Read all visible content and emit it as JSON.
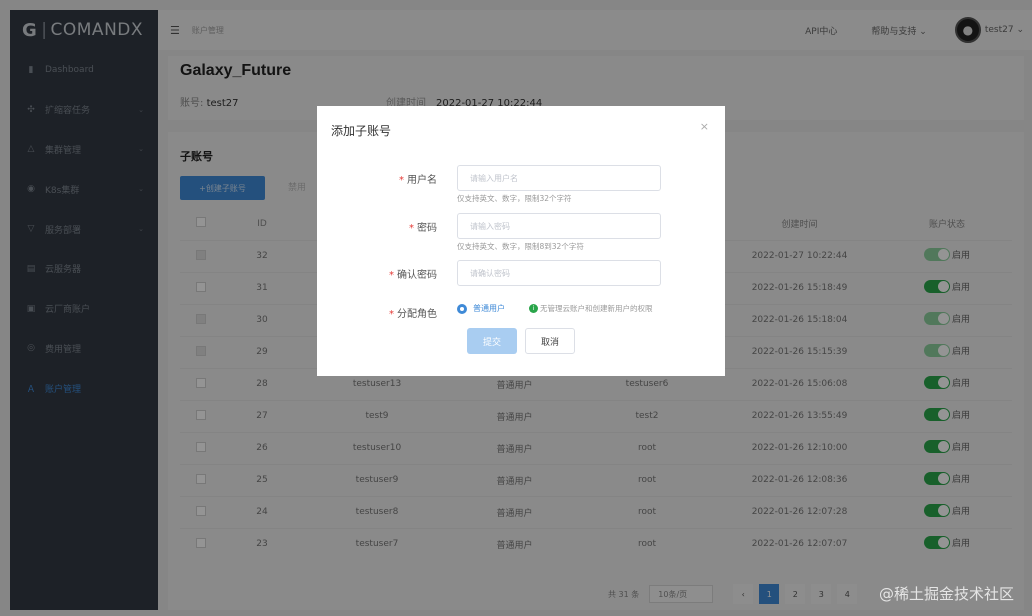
{
  "app": {
    "logo_text": "COMANDX"
  },
  "sidebar": {
    "items": [
      {
        "label": "Dashboard",
        "icon": "bar-chart-icon",
        "glyph": "▮",
        "chevron": false
      },
      {
        "label": "扩缩容任务",
        "icon": "scale-icon",
        "glyph": "✣",
        "chevron": true
      },
      {
        "label": "集群管理",
        "icon": "cluster-icon",
        "glyph": "△",
        "chevron": true
      },
      {
        "label": "K8s集群",
        "icon": "k8s-icon",
        "glyph": "◉",
        "chevron": true
      },
      {
        "label": "服务部署",
        "icon": "deploy-icon",
        "glyph": "▽",
        "chevron": true
      },
      {
        "label": "云服务器",
        "icon": "server-icon",
        "glyph": "▤",
        "chevron": false
      },
      {
        "label": "云厂商账户",
        "icon": "vendor-icon",
        "glyph": "▣",
        "chevron": false
      },
      {
        "label": "费用管理",
        "icon": "billing-icon",
        "glyph": "◎",
        "chevron": false
      },
      {
        "label": "账户管理",
        "icon": "user-icon",
        "glyph": "Ａ",
        "chevron": false,
        "active": true
      }
    ]
  },
  "topbar": {
    "breadcrumb": "账户管理",
    "api_center": "API中心",
    "help": "帮助与支持",
    "username": "test27"
  },
  "account": {
    "name": "Galaxy_Future",
    "account_label": "账号:",
    "account_value": "test27",
    "created_label": "创建时间",
    "created_value": "2022-01-27 10:22:44"
  },
  "subaccounts": {
    "title": "子账号",
    "create_button": "+创建子账号",
    "disable_button": "禁用",
    "columns": {
      "id": "ID",
      "created": "创建时间",
      "status": "账户状态"
    },
    "rows": [
      {
        "id": "32",
        "user": "",
        "role": "",
        "creator": "",
        "created": "2022-01-27 10:22:44",
        "status": "启用",
        "checkbox_disabled": true
      },
      {
        "id": "31",
        "user": "",
        "role": "",
        "creator": "",
        "created": "2022-01-26 15:18:49",
        "status": "启用",
        "checkbox_disabled": false
      },
      {
        "id": "30",
        "user": "",
        "role": "",
        "creator": "",
        "created": "2022-01-26 15:18:04",
        "status": "启用",
        "checkbox_disabled": true
      },
      {
        "id": "29",
        "user": "",
        "role": "",
        "creator": "",
        "created": "2022-01-26 15:15:39",
        "status": "启用",
        "checkbox_disabled": true
      },
      {
        "id": "28",
        "user": "testuser13",
        "role": "普通用户",
        "creator": "testuser6",
        "created": "2022-01-26 15:06:08",
        "status": "启用",
        "checkbox_disabled": false
      },
      {
        "id": "27",
        "user": "test9",
        "role": "普通用户",
        "creator": "test2",
        "created": "2022-01-26 13:55:49",
        "status": "启用",
        "checkbox_disabled": false
      },
      {
        "id": "26",
        "user": "testuser10",
        "role": "普通用户",
        "creator": "root",
        "created": "2022-01-26 12:10:00",
        "status": "启用",
        "checkbox_disabled": false
      },
      {
        "id": "25",
        "user": "testuser9",
        "role": "普通用户",
        "creator": "root",
        "created": "2022-01-26 12:08:36",
        "status": "启用",
        "checkbox_disabled": false
      },
      {
        "id": "24",
        "user": "testuser8",
        "role": "普通用户",
        "creator": "root",
        "created": "2022-01-26 12:07:28",
        "status": "启用",
        "checkbox_disabled": false
      },
      {
        "id": "23",
        "user": "testuser7",
        "role": "普通用户",
        "creator": "root",
        "created": "2022-01-26 12:07:07",
        "status": "启用",
        "checkbox_disabled": false
      }
    ]
  },
  "pagination": {
    "total": "共 31 条",
    "page_size": "10条/页",
    "pages": [
      "1",
      "2",
      "3",
      "4"
    ],
    "current": "1"
  },
  "modal": {
    "title": "添加子账号",
    "close": "×",
    "username_label": "用户名",
    "username_placeholder": "请输入用户名",
    "username_hint": "仅支持英文、数字，限制32个字符",
    "password_label": "密码",
    "password_placeholder": "请输入密码",
    "password_hint": "仅支持英文、数字，限制8到32个字符",
    "confirm_label": "确认密码",
    "confirm_placeholder": "请确认密码",
    "role_label": "分配角色",
    "role_option": "普通用户",
    "role_note": "无管理云账户和创建新用户的权限",
    "submit": "提交",
    "cancel": "取消"
  },
  "watermark": "@稀土掘金技术社区",
  "colors": {
    "accent": "#3f8ad7",
    "sidebar_bg": "#333a44",
    "switch_on": "#2aa54a",
    "required": "#e53935"
  }
}
